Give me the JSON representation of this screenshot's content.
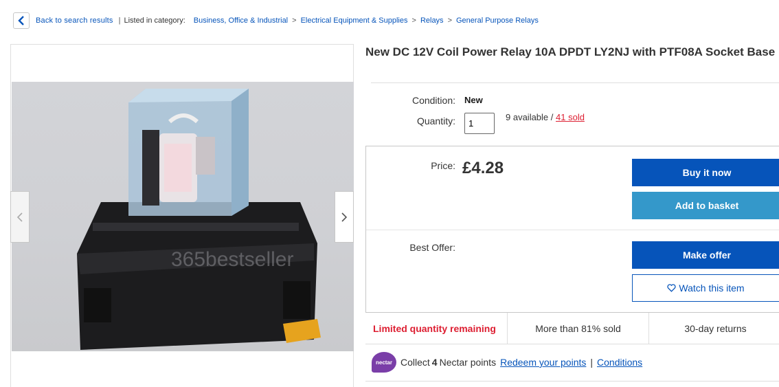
{
  "breadcrumb": {
    "back_label": "Back to search results",
    "listed_label": "Listed in category:",
    "categories": [
      "Business, Office & Industrial",
      "Electrical Equipment & Supplies",
      "Relays",
      "General Purpose Relays"
    ]
  },
  "gallery": {
    "watermark": "365bestseller"
  },
  "listing": {
    "title": "New DC 12V Coil Power Relay 10A DPDT LY2NJ with PTF08A Socket Base",
    "condition_label": "Condition:",
    "condition_value": "New",
    "quantity_label": "Quantity:",
    "quantity_value": "1",
    "available_text": "9 available /",
    "sold_text": "41 sold"
  },
  "purchase": {
    "price_label": "Price:",
    "price": "£4.28",
    "buy_now": "Buy it now",
    "add_to_basket": "Add to basket",
    "best_offer_label": "Best Offer:",
    "make_offer": "Make offer",
    "watch": "Watch this item"
  },
  "highlights": [
    "Limited quantity remaining",
    "More than 81% sold",
    "30-day returns"
  ],
  "nectar": {
    "badge": "nectar",
    "collect_prefix": "Collect ",
    "points": "4",
    "collect_suffix": " Nectar points",
    "redeem_link": "Redeem your points",
    "conditions_link": "Conditions"
  },
  "colors": {
    "brand_blue": "#0654ba",
    "secondary_blue": "#3498ca",
    "alert_red": "#dd1e31",
    "nectar_purple": "#7a3ea8"
  }
}
